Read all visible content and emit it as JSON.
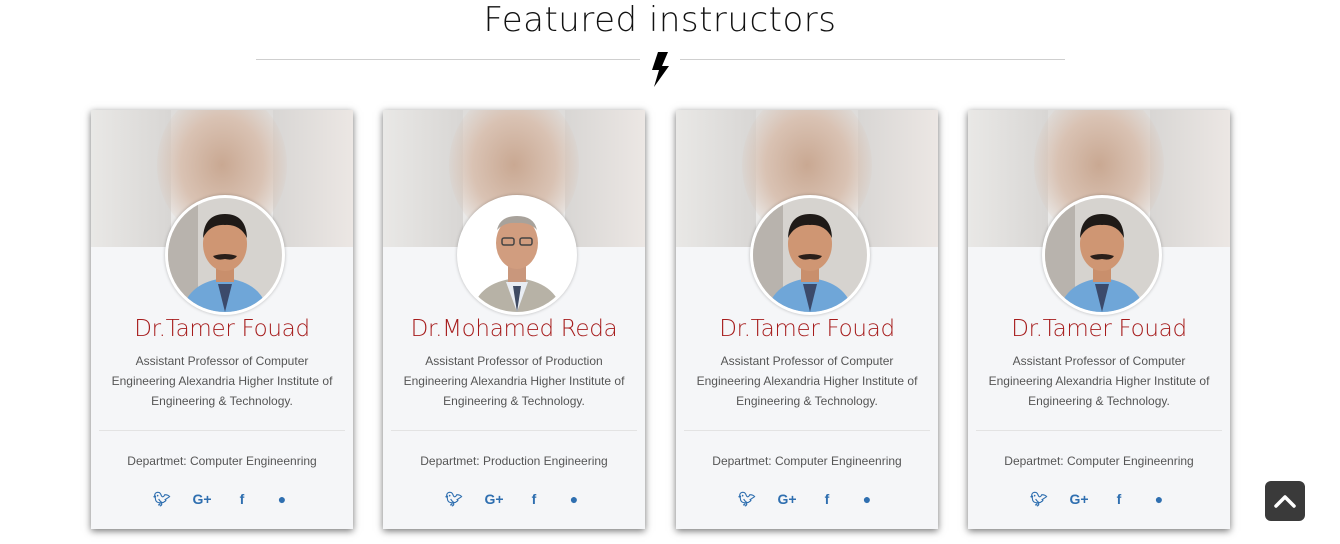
{
  "section": {
    "title": "Featured instructors"
  },
  "social_icons": [
    "twitter-icon",
    "google-plus-icon",
    "facebook-icon",
    "globe-icon"
  ],
  "instructors": [
    {
      "name": "Dr.Tamer Fouad",
      "description": "Assistant Professor of Computer Engineering Alexandria Higher Institute of Engineering & Technology.",
      "department": "Departmet: Computer Engineenring"
    },
    {
      "name": "Dr.Mohamed Reda",
      "description": "Assistant Professor of Production Engineering Alexandria Higher Institute of Engineering & Technology.",
      "department": "Departmet: Production Engineering"
    },
    {
      "name": "Dr.Tamer Fouad",
      "description": "Assistant Professor of Computer Engineering Alexandria Higher Institute of Engineering & Technology.",
      "department": "Departmet: Computer Engineenring"
    },
    {
      "name": "Dr.Tamer Fouad",
      "description": "Assistant Professor of Computer Engineering Alexandria Higher Institute of Engineering & Technology.",
      "department": "Departmet: Computer Engineenring"
    }
  ],
  "colors": {
    "name": "#a61c1c",
    "social": "#2f6fb0",
    "back_to_top_bg": "#3a3a3a"
  }
}
